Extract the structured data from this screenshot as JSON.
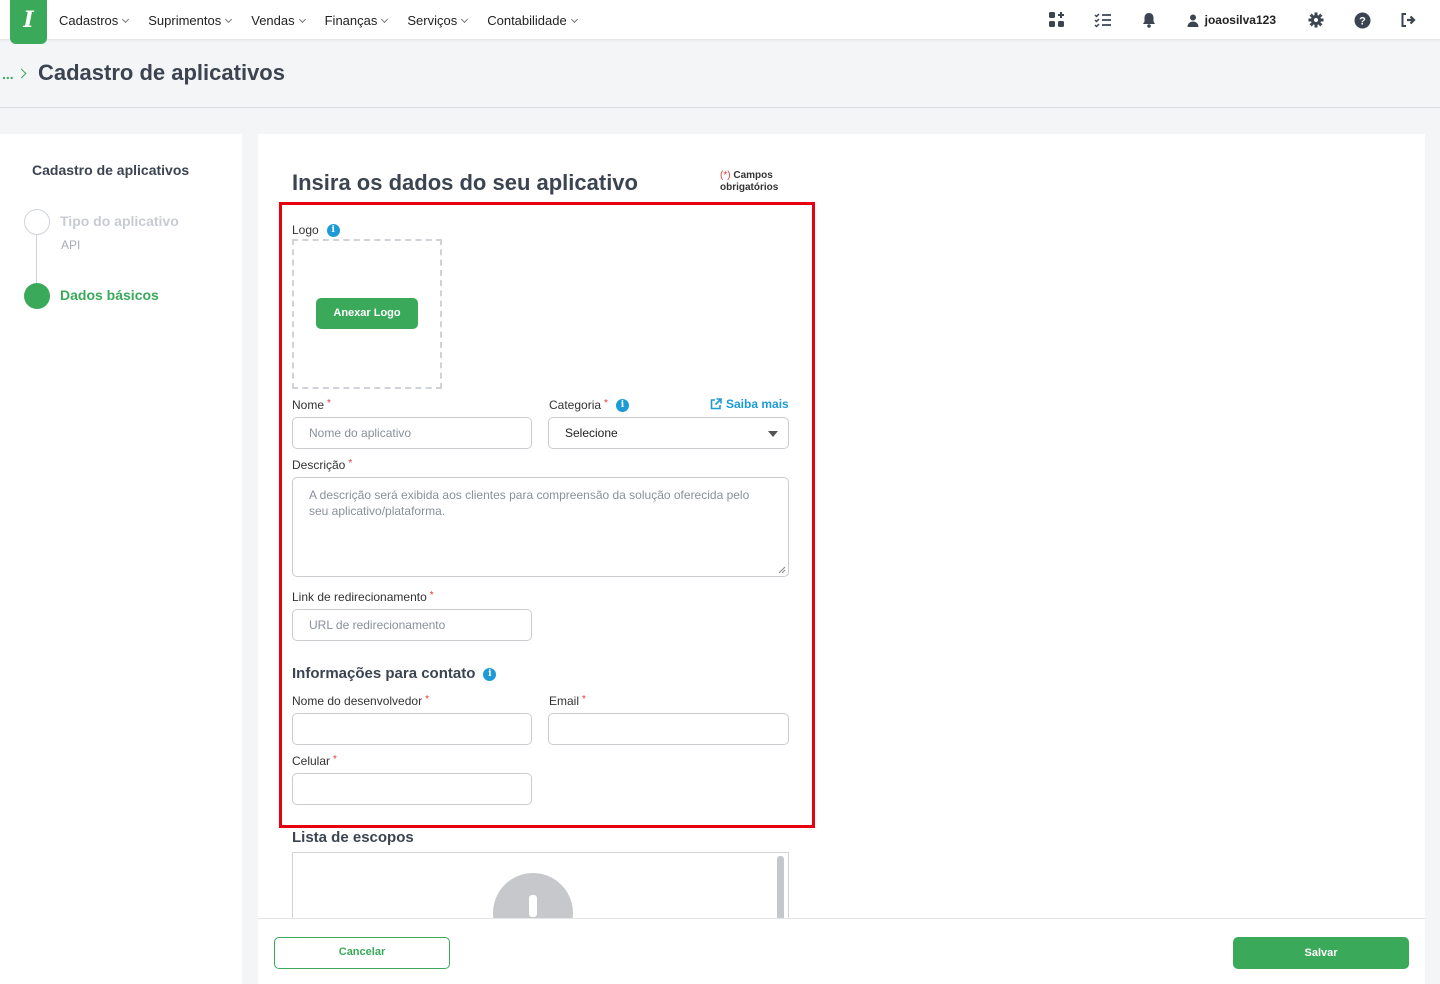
{
  "nav": {
    "logo_text": "I",
    "items": [
      {
        "label": "Cadastros"
      },
      {
        "label": "Suprimentos"
      },
      {
        "label": "Vendas"
      },
      {
        "label": "Finanças"
      },
      {
        "label": "Serviços"
      },
      {
        "label": "Contabilidade"
      }
    ],
    "username": "joaosilva123",
    "icons": [
      "apps-icon",
      "tasks-icon",
      "bell-icon",
      "user-icon",
      "gear-icon",
      "help-icon",
      "logout-icon"
    ]
  },
  "breadcrumb": {
    "ellipsis": "...",
    "title": "Cadastro de aplicativos"
  },
  "stepper": {
    "title": "Cadastro de aplicativos",
    "steps": [
      {
        "label": "Tipo do aplicativo",
        "sub": "API",
        "state": "done"
      },
      {
        "label": "Dados básicos",
        "state": "active"
      }
    ]
  },
  "form": {
    "title": "Insira os dados do seu aplicativo",
    "required_note_star": "(*)",
    "required_note_text1": "Campos",
    "required_note_text2": "obrigatórios",
    "logo_label": "Logo",
    "attach_logo_button": "Anexar Logo",
    "nome_label": "Nome",
    "nome_placeholder": "Nome do aplicativo",
    "categoria_label": "Categoria",
    "categoria_value": "Selecione",
    "saiba_mais": "Saiba mais",
    "descricao_label": "Descrição",
    "descricao_placeholder": "A descrição será exibida aos clientes para compreensão da solução oferecida pelo seu aplicativo/plataforma.",
    "link_label": "Link de redirecionamento",
    "link_placeholder": "URL de redirecionamento",
    "contact_section": "Informações para contato",
    "dev_name_label": "Nome do desenvolvedor",
    "email_label": "Email",
    "celular_label": "Celular",
    "scopes_section": "Lista de escopos",
    "required_mark": "*"
  },
  "footer": {
    "cancel": "Cancelar",
    "save": "Salvar"
  },
  "colors": {
    "brand": "#3aaa5a",
    "info": "#1e9ad6",
    "highlight": "#e8000e"
  }
}
